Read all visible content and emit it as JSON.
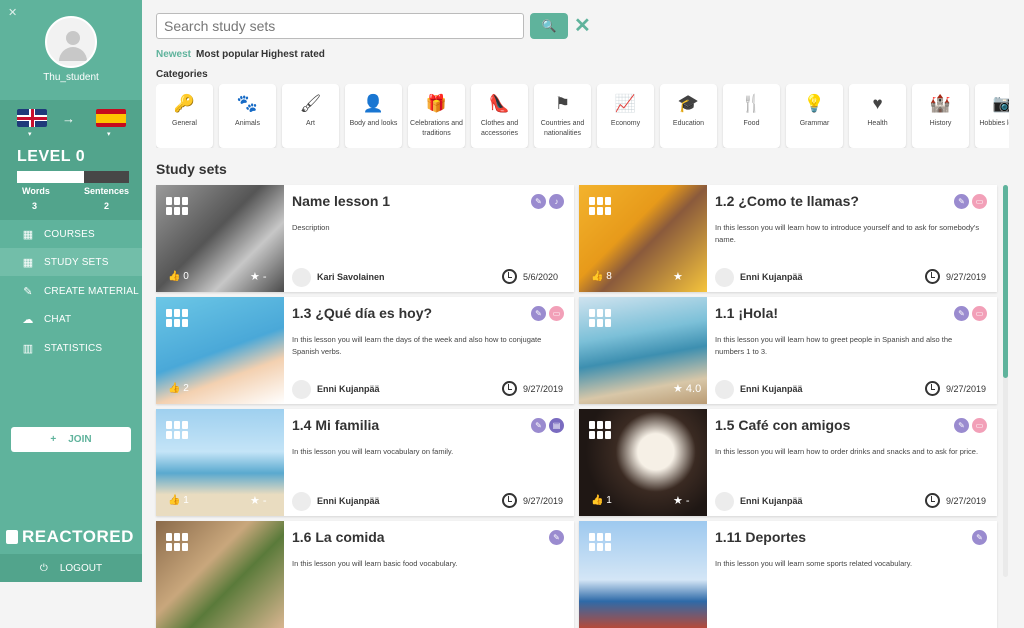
{
  "sidebar": {
    "close_glyph": "✕",
    "username": "Thu_student",
    "from_flag": "flag-uk",
    "to_flag": "flag-es",
    "arrow": "→",
    "caret": "▾",
    "level": "LEVEL 0",
    "words_label": "Words",
    "words_value": "3",
    "sentences_label": "Sentences",
    "sentences_value": "2",
    "level_progress": 0.6,
    "nav": [
      {
        "label": "COURSES",
        "icon": "▦"
      },
      {
        "label": "STUDY SETS",
        "icon": "▦",
        "active": true
      },
      {
        "label": "CREATE MATERIAL",
        "icon": "✎"
      },
      {
        "label": "CHAT",
        "icon": "☁"
      },
      {
        "label": "STATISTICS",
        "icon": "▥"
      }
    ],
    "join_plus": "+",
    "join_label": "JOIN",
    "brand": "REACTORED",
    "logout_icon": "⏻",
    "logout_label": "LOGOUT"
  },
  "search": {
    "placeholder": "Search study sets",
    "button_icon": "🔍",
    "clear_icon": "✕"
  },
  "sort": {
    "newest": "Newest",
    "popular": "Most popular",
    "rated": "Highest rated"
  },
  "categories_title": "Categories",
  "categories": [
    {
      "label": "General",
      "icon": "🔑"
    },
    {
      "label": "Animals",
      "icon": "🐾"
    },
    {
      "label": "Art",
      "icon": "🖌"
    },
    {
      "label": "Body and looks",
      "icon": "👤"
    },
    {
      "label": "Celebrations and traditions",
      "icon": "🎁"
    },
    {
      "label": "Clothes and accessories",
      "icon": "👠"
    },
    {
      "label": "Countries and nationalities",
      "icon": "⚑"
    },
    {
      "label": "Economy",
      "icon": "📈"
    },
    {
      "label": "Education",
      "icon": "🎓"
    },
    {
      "label": "Food",
      "icon": "🍴"
    },
    {
      "label": "Grammar",
      "icon": "💡"
    },
    {
      "label": "Health",
      "icon": "♥"
    },
    {
      "label": "History",
      "icon": "🏰"
    },
    {
      "label": "Hobbies leisure",
      "icon": "📷"
    }
  ],
  "study_sets_title": "Study sets",
  "cards": [
    {
      "title": "Name lesson 1",
      "desc": "Description",
      "author": "Kari Savolainen",
      "date": "5/6/2020",
      "likes": "0",
      "rating": "★ -",
      "badge": "speaker-icon",
      "badge_glyph": "♪",
      "badge_color": "#9a8bcf",
      "img": "linear-gradient(135deg,#9a9a9a,#555 45%,#c7c7c7 70%,#4a4a4a)"
    },
    {
      "title": "1.2 ¿Como te llamas?",
      "desc": "In this lesson you will learn how to introduce yourself and to ask for somebody's name.",
      "author": "Enni Kujanpää",
      "date": "9/27/2019",
      "likes": "8",
      "rating": "★",
      "badge": "flashcard-icon",
      "badge_glyph": "▭",
      "badge_color": "#f2a0b8",
      "img": "linear-gradient(135deg,#f3b32d,#e79a1a 40%,#8a5a3c 55%,#f5c43c)"
    },
    {
      "title": "1.3 ¿Qué día es hoy?",
      "desc": "In this lesson you will learn the days of the week and also how to conjugate Spanish verbs.",
      "author": "Enni Kujanpää",
      "date": "9/27/2019",
      "likes": "2",
      "rating": "",
      "badge": "flashcard-icon",
      "badge_glyph": "▭",
      "badge_color": "#f2a0b8",
      "img": "linear-gradient(160deg,#6cc7e6,#4aa8d8 50%,#f3d0b0 70%,#ffffff)"
    },
    {
      "title": "1.1 ¡Hola!",
      "desc": "In this lesson you will learn how to greet people in Spanish and also the numbers 1 to 3.",
      "author": "Enni Kujanpää",
      "date": "9/27/2019",
      "likes": "",
      "rating": "★ 4.0",
      "badge": "flashcard-icon",
      "badge_glyph": "▭",
      "badge_color": "#f2a0b8",
      "img": "linear-gradient(170deg,#cfe3ef,#7cc0d8 35%,#3d8fb0 55%,#d8c7a8 80%,#b99b74)"
    },
    {
      "title": "1.4 Mi familia",
      "desc": "In this lesson you will learn vocabulary on family.",
      "author": "Enni Kujanpää",
      "date": "9/27/2019",
      "likes": "1",
      "rating": "★ -",
      "badge": "document-icon",
      "badge_glyph": "▤",
      "badge_color": "#7a6bc0",
      "img": "linear-gradient(180deg,#9fd0ef,#c4e4f7 40%,#5aa9cf 60%,#e9dcc0 80%)"
    },
    {
      "title": "1.5 Café con amigos",
      "desc": "In this lesson you will learn how to order drinks and snacks and to ask for price.",
      "author": "Enni Kujanpää",
      "date": "9/27/2019",
      "likes": "1",
      "rating": "★ -",
      "badge": "flashcard-icon",
      "badge_glyph": "▭",
      "badge_color": "#f2a0b8",
      "img": "radial-gradient(circle at 60% 40%,#f6f0e6 0 18%,#3a2a22 40%,#1f1714 70%)"
    },
    {
      "title": "1.6 La comida",
      "desc": "In this lesson you will learn basic food vocabulary.",
      "author": "",
      "date": "",
      "likes": "",
      "rating": "",
      "badge": "",
      "badge_glyph": "",
      "badge_color": "",
      "img": "linear-gradient(135deg,#8a6a4a,#c9a77c 40%,#5a7a3a 60%,#d8b590)"
    },
    {
      "title": "1.11 Deportes",
      "desc": "In this lesson you will learn some sports related vocabulary.",
      "author": "",
      "date": "",
      "likes": "",
      "rating": "",
      "badge": "",
      "badge_glyph": "",
      "badge_color": "",
      "img": "linear-gradient(180deg,#9ec9ef,#d4e6f6 55%,#2e6aa8 75%,#b54a3a)"
    }
  ]
}
